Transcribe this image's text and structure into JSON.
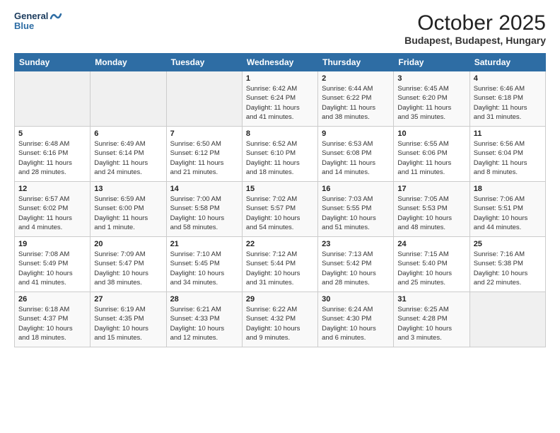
{
  "header": {
    "logo_line1": "General",
    "logo_line2": "Blue",
    "month": "October 2025",
    "location": "Budapest, Budapest, Hungary"
  },
  "days_of_week": [
    "Sunday",
    "Monday",
    "Tuesday",
    "Wednesday",
    "Thursday",
    "Friday",
    "Saturday"
  ],
  "weeks": [
    [
      {
        "num": "",
        "info": ""
      },
      {
        "num": "",
        "info": ""
      },
      {
        "num": "",
        "info": ""
      },
      {
        "num": "1",
        "info": "Sunrise: 6:42 AM\nSunset: 6:24 PM\nDaylight: 11 hours\nand 41 minutes."
      },
      {
        "num": "2",
        "info": "Sunrise: 6:44 AM\nSunset: 6:22 PM\nDaylight: 11 hours\nand 38 minutes."
      },
      {
        "num": "3",
        "info": "Sunrise: 6:45 AM\nSunset: 6:20 PM\nDaylight: 11 hours\nand 35 minutes."
      },
      {
        "num": "4",
        "info": "Sunrise: 6:46 AM\nSunset: 6:18 PM\nDaylight: 11 hours\nand 31 minutes."
      }
    ],
    [
      {
        "num": "5",
        "info": "Sunrise: 6:48 AM\nSunset: 6:16 PM\nDaylight: 11 hours\nand 28 minutes."
      },
      {
        "num": "6",
        "info": "Sunrise: 6:49 AM\nSunset: 6:14 PM\nDaylight: 11 hours\nand 24 minutes."
      },
      {
        "num": "7",
        "info": "Sunrise: 6:50 AM\nSunset: 6:12 PM\nDaylight: 11 hours\nand 21 minutes."
      },
      {
        "num": "8",
        "info": "Sunrise: 6:52 AM\nSunset: 6:10 PM\nDaylight: 11 hours\nand 18 minutes."
      },
      {
        "num": "9",
        "info": "Sunrise: 6:53 AM\nSunset: 6:08 PM\nDaylight: 11 hours\nand 14 minutes."
      },
      {
        "num": "10",
        "info": "Sunrise: 6:55 AM\nSunset: 6:06 PM\nDaylight: 11 hours\nand 11 minutes."
      },
      {
        "num": "11",
        "info": "Sunrise: 6:56 AM\nSunset: 6:04 PM\nDaylight: 11 hours\nand 8 minutes."
      }
    ],
    [
      {
        "num": "12",
        "info": "Sunrise: 6:57 AM\nSunset: 6:02 PM\nDaylight: 11 hours\nand 4 minutes."
      },
      {
        "num": "13",
        "info": "Sunrise: 6:59 AM\nSunset: 6:00 PM\nDaylight: 11 hours\nand 1 minute."
      },
      {
        "num": "14",
        "info": "Sunrise: 7:00 AM\nSunset: 5:58 PM\nDaylight: 10 hours\nand 58 minutes."
      },
      {
        "num": "15",
        "info": "Sunrise: 7:02 AM\nSunset: 5:57 PM\nDaylight: 10 hours\nand 54 minutes."
      },
      {
        "num": "16",
        "info": "Sunrise: 7:03 AM\nSunset: 5:55 PM\nDaylight: 10 hours\nand 51 minutes."
      },
      {
        "num": "17",
        "info": "Sunrise: 7:05 AM\nSunset: 5:53 PM\nDaylight: 10 hours\nand 48 minutes."
      },
      {
        "num": "18",
        "info": "Sunrise: 7:06 AM\nSunset: 5:51 PM\nDaylight: 10 hours\nand 44 minutes."
      }
    ],
    [
      {
        "num": "19",
        "info": "Sunrise: 7:08 AM\nSunset: 5:49 PM\nDaylight: 10 hours\nand 41 minutes."
      },
      {
        "num": "20",
        "info": "Sunrise: 7:09 AM\nSunset: 5:47 PM\nDaylight: 10 hours\nand 38 minutes."
      },
      {
        "num": "21",
        "info": "Sunrise: 7:10 AM\nSunset: 5:45 PM\nDaylight: 10 hours\nand 34 minutes."
      },
      {
        "num": "22",
        "info": "Sunrise: 7:12 AM\nSunset: 5:44 PM\nDaylight: 10 hours\nand 31 minutes."
      },
      {
        "num": "23",
        "info": "Sunrise: 7:13 AM\nSunset: 5:42 PM\nDaylight: 10 hours\nand 28 minutes."
      },
      {
        "num": "24",
        "info": "Sunrise: 7:15 AM\nSunset: 5:40 PM\nDaylight: 10 hours\nand 25 minutes."
      },
      {
        "num": "25",
        "info": "Sunrise: 7:16 AM\nSunset: 5:38 PM\nDaylight: 10 hours\nand 22 minutes."
      }
    ],
    [
      {
        "num": "26",
        "info": "Sunrise: 6:18 AM\nSunset: 4:37 PM\nDaylight: 10 hours\nand 18 minutes."
      },
      {
        "num": "27",
        "info": "Sunrise: 6:19 AM\nSunset: 4:35 PM\nDaylight: 10 hours\nand 15 minutes."
      },
      {
        "num": "28",
        "info": "Sunrise: 6:21 AM\nSunset: 4:33 PM\nDaylight: 10 hours\nand 12 minutes."
      },
      {
        "num": "29",
        "info": "Sunrise: 6:22 AM\nSunset: 4:32 PM\nDaylight: 10 hours\nand 9 minutes."
      },
      {
        "num": "30",
        "info": "Sunrise: 6:24 AM\nSunset: 4:30 PM\nDaylight: 10 hours\nand 6 minutes."
      },
      {
        "num": "31",
        "info": "Sunrise: 6:25 AM\nSunset: 4:28 PM\nDaylight: 10 hours\nand 3 minutes."
      },
      {
        "num": "",
        "info": ""
      }
    ]
  ]
}
